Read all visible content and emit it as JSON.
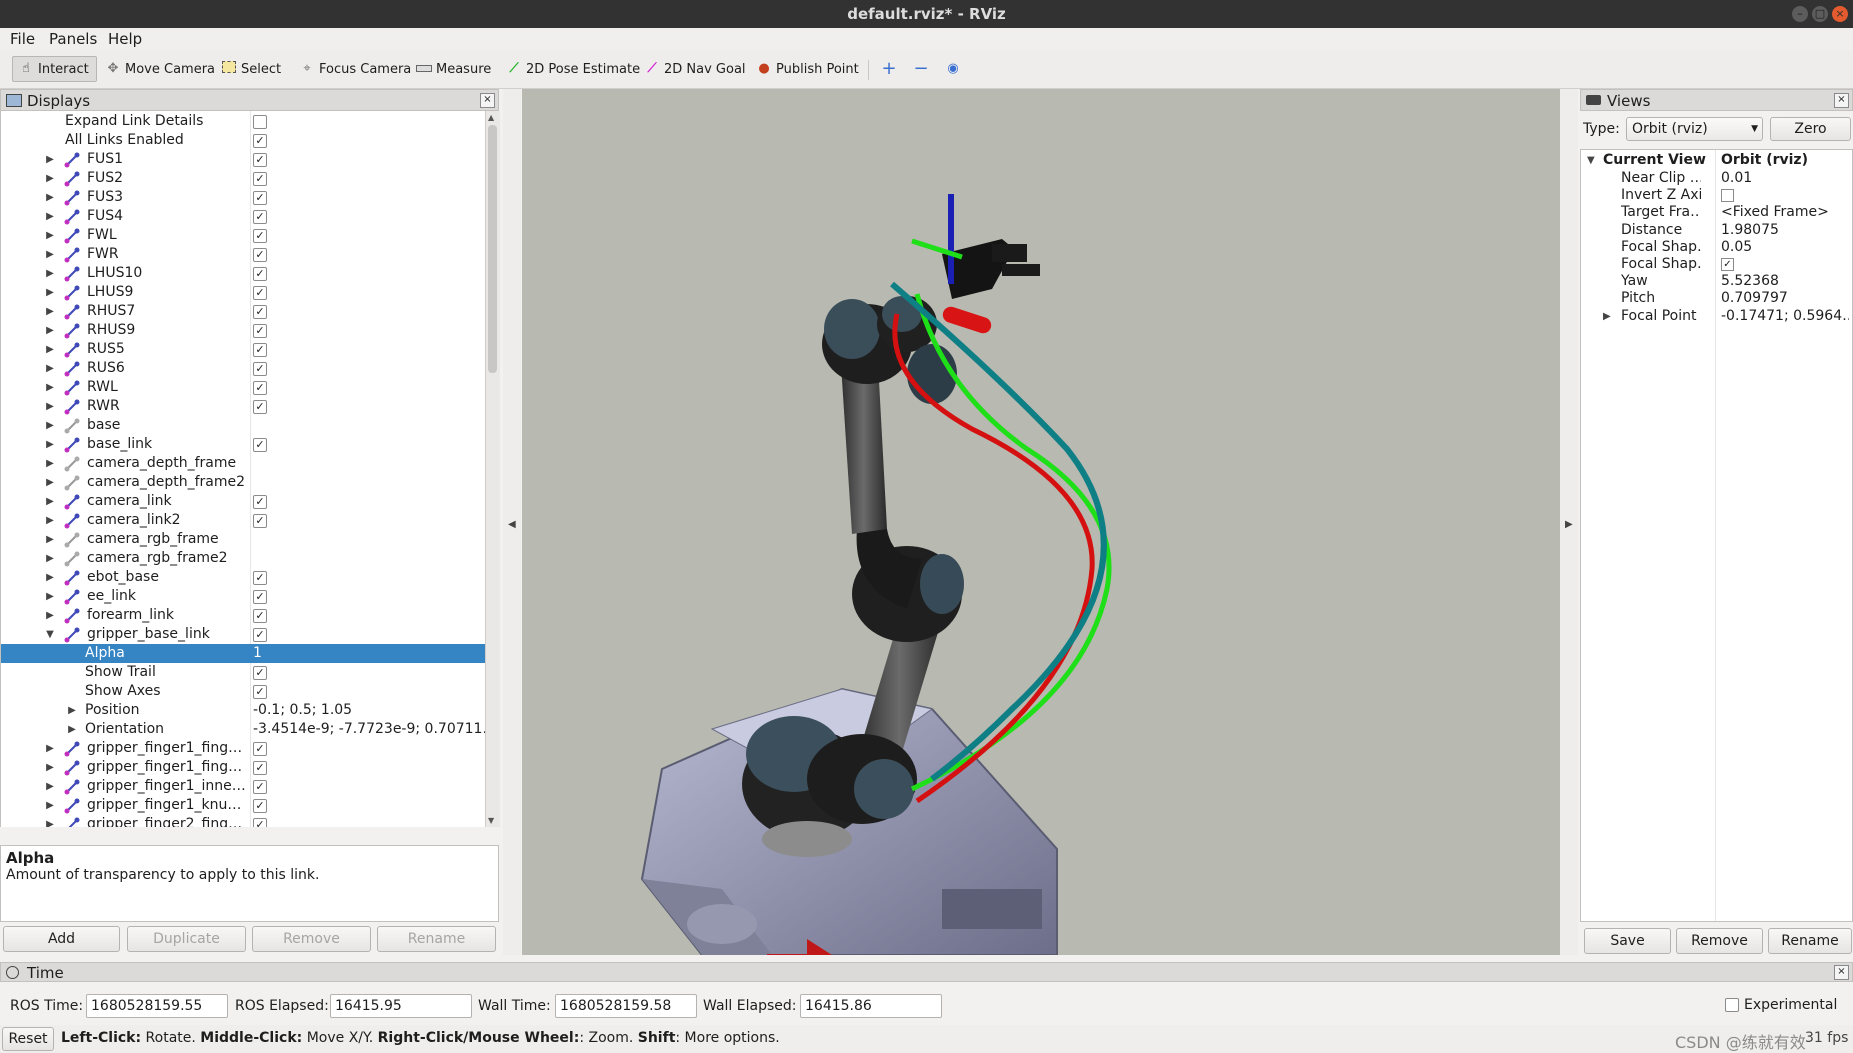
{
  "window": {
    "title": "default.rviz* - RViz"
  },
  "menu": [
    "File",
    "Panels",
    "Help"
  ],
  "toolbar": {
    "tools": [
      {
        "label": "Interact",
        "icon": "hand-icon",
        "active": true
      },
      {
        "label": "Move Camera",
        "icon": "move-camera-icon"
      },
      {
        "label": "Select",
        "icon": "select-icon"
      },
      {
        "label": "Focus Camera",
        "icon": "focus-camera-icon"
      },
      {
        "label": "Measure",
        "icon": "ruler-icon"
      },
      {
        "label": "2D Pose Estimate",
        "icon": "pose-arrow-icon"
      },
      {
        "label": "2D Nav Goal",
        "icon": "nav-arrow-icon"
      },
      {
        "label": "Publish Point",
        "icon": "map-pin-icon"
      }
    ]
  },
  "displays": {
    "title": "Displays",
    "rows": [
      {
        "name": "Expand Link Details",
        "indent": 1,
        "checkbox": "off"
      },
      {
        "name": "All Links Enabled",
        "indent": 1,
        "checkbox": "on"
      },
      {
        "name": "FUS1",
        "indent": 2,
        "link": true,
        "checkbox": "on"
      },
      {
        "name": "FUS2",
        "indent": 2,
        "link": true,
        "checkbox": "on"
      },
      {
        "name": "FUS3",
        "indent": 2,
        "link": true,
        "checkbox": "on"
      },
      {
        "name": "FUS4",
        "indent": 2,
        "link": true,
        "checkbox": "on"
      },
      {
        "name": "FWL",
        "indent": 2,
        "link": true,
        "checkbox": "on"
      },
      {
        "name": "FWR",
        "indent": 2,
        "link": true,
        "checkbox": "on"
      },
      {
        "name": "LHUS10",
        "indent": 2,
        "link": true,
        "checkbox": "on"
      },
      {
        "name": "LHUS9",
        "indent": 2,
        "link": true,
        "checkbox": "on"
      },
      {
        "name": "RHUS7",
        "indent": 2,
        "link": true,
        "checkbox": "on"
      },
      {
        "name": "RHUS9",
        "indent": 2,
        "link": true,
        "checkbox": "on"
      },
      {
        "name": "RUS5",
        "indent": 2,
        "link": true,
        "checkbox": "on"
      },
      {
        "name": "RUS6",
        "indent": 2,
        "link": true,
        "checkbox": "on"
      },
      {
        "name": "RWL",
        "indent": 2,
        "link": true,
        "checkbox": "on"
      },
      {
        "name": "RWR",
        "indent": 2,
        "link": true,
        "checkbox": "on"
      },
      {
        "name": "base",
        "indent": 2,
        "link": true,
        "gray": true
      },
      {
        "name": "base_link",
        "indent": 2,
        "link": true,
        "checkbox": "on"
      },
      {
        "name": "camera_depth_frame",
        "indent": 2,
        "link": true,
        "gray": true
      },
      {
        "name": "camera_depth_frame2",
        "indent": 2,
        "link": true,
        "gray": true
      },
      {
        "name": "camera_link",
        "indent": 2,
        "link": true,
        "checkbox": "on"
      },
      {
        "name": "camera_link2",
        "indent": 2,
        "link": true,
        "checkbox": "on"
      },
      {
        "name": "camera_rgb_frame",
        "indent": 2,
        "link": true,
        "gray": true
      },
      {
        "name": "camera_rgb_frame2",
        "indent": 2,
        "link": true,
        "gray": true
      },
      {
        "name": "ebot_base",
        "indent": 2,
        "link": true,
        "checkbox": "on"
      },
      {
        "name": "ee_link",
        "indent": 2,
        "link": true,
        "checkbox": "on"
      },
      {
        "name": "forearm_link",
        "indent": 2,
        "link": true,
        "checkbox": "on"
      },
      {
        "name": "gripper_base_link",
        "indent": 2,
        "link": true,
        "checkbox": "on",
        "expanded": true
      },
      {
        "name": "Alpha",
        "indent": 3,
        "value": "1",
        "selected": true
      },
      {
        "name": "Show Trail",
        "indent": 3,
        "checkbox": "on"
      },
      {
        "name": "Show Axes",
        "indent": 3,
        "checkbox": "on"
      },
      {
        "name": "Position",
        "indent": 3,
        "value": "-0.1; 0.5; 1.05",
        "expandable": true
      },
      {
        "name": "Orientation",
        "indent": 3,
        "value": "-3.4514e-9; -7.7723e-9; 0.70711…",
        "expandable": true
      },
      {
        "name": "gripper_finger1_fing…",
        "indent": 2,
        "link": true,
        "checkbox": "on"
      },
      {
        "name": "gripper_finger1_fing…",
        "indent": 2,
        "link": true,
        "checkbox": "on"
      },
      {
        "name": "gripper_finger1_inne…",
        "indent": 2,
        "link": true,
        "checkbox": "on"
      },
      {
        "name": "gripper_finger1_knu…",
        "indent": 2,
        "link": true,
        "checkbox": "on"
      },
      {
        "name": "gripper_finger2_fing…",
        "indent": 2,
        "link": true,
        "checkbox": "on"
      }
    ],
    "description": {
      "heading": "Alpha",
      "body": "Amount of transparency to apply to this link."
    },
    "buttons": {
      "add": "Add",
      "duplicate": "Duplicate",
      "remove": "Remove",
      "rename": "Rename"
    }
  },
  "views": {
    "title": "Views",
    "type_label": "Type:",
    "type_value": "Orbit (rviz)",
    "zero_label": "Zero",
    "current_view_label": "Current View",
    "current_view_value": "Orbit (rviz)",
    "props": [
      {
        "k": "Near Clip …",
        "v": "0.01"
      },
      {
        "k": "Invert Z Axis",
        "checkbox": "off"
      },
      {
        "k": "Target Fra…",
        "v": "<Fixed Frame>"
      },
      {
        "k": "Distance",
        "v": "1.98075"
      },
      {
        "k": "Focal Shap…",
        "v": "0.05"
      },
      {
        "k": "Focal Shap…",
        "checkbox": "on"
      },
      {
        "k": "Yaw",
        "v": "5.52368"
      },
      {
        "k": "Pitch",
        "v": "0.709797"
      },
      {
        "k": "Focal Point",
        "v": "-0.17471; 0.5964…",
        "expandable": true
      }
    ],
    "buttons": {
      "save": "Save",
      "remove": "Remove",
      "rename": "Rename"
    }
  },
  "time": {
    "title": "Time",
    "ros_time_label": "ROS Time:",
    "ros_time": "1680528159.55",
    "ros_elapsed_label": "ROS Elapsed:",
    "ros_elapsed": "16415.95",
    "wall_time_label": "Wall Time:",
    "wall_time": "1680528159.58",
    "wall_elapsed_label": "Wall Elapsed:",
    "wall_elapsed": "16415.86",
    "experimental_label": "Experimental"
  },
  "status": {
    "reset": "Reset",
    "left_click_b": "Left-Click:",
    "left_click": " Rotate. ",
    "middle_click_b": "Middle-Click:",
    "middle_click": " Move X/Y. ",
    "right_click_b": "Right-Click/Mouse Wheel:",
    "right_click": ": Zoom. ",
    "shift_b": "Shift",
    "shift": ": More options.",
    "watermark": "CSDN @练就有效",
    "fps": "31 fps"
  },
  "colors": {
    "selection": "#3584c4",
    "viewport_bg": "#b8b9b0",
    "trail_red": "#d51010",
    "trail_green": "#1fe018",
    "trail_teal": "#0f7f86"
  }
}
